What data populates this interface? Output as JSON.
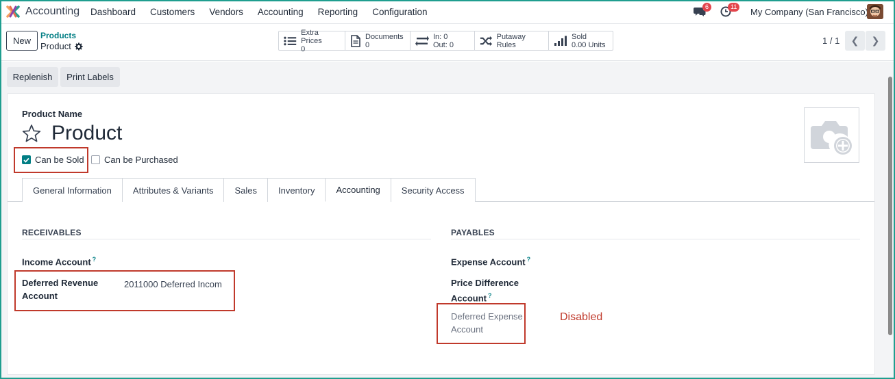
{
  "navbar": {
    "app_name": "Accounting",
    "menu": [
      "Dashboard",
      "Customers",
      "Vendors",
      "Accounting",
      "Reporting",
      "Configuration"
    ],
    "chat_badge": "6",
    "activity_badge": "11",
    "company": "My Company (San Francisco)"
  },
  "control_panel": {
    "new_label": "New",
    "breadcrumb_parent": "Products",
    "breadcrumb_current": "Product",
    "smart_buttons": [
      {
        "icon": "list-icon",
        "label": "Extra Prices",
        "value": "0"
      },
      {
        "icon": "document-icon",
        "label": "Documents",
        "value": "0"
      },
      {
        "icon": "transfer-icon",
        "label": "In: 0",
        "value": "Out: 0"
      },
      {
        "icon": "shuffle-icon",
        "label": "Putaway Rules",
        "value": ""
      },
      {
        "icon": "bar-chart-icon",
        "label": "Sold",
        "value": "0.00 Units"
      }
    ],
    "pager": "1 / 1"
  },
  "actions": {
    "replenish": "Replenish",
    "print_labels": "Print Labels"
  },
  "form": {
    "product_name_label": "Product Name",
    "product_name": "Product",
    "can_be_sold": "Can be Sold",
    "can_be_purchased": "Can be Purchased",
    "tabs": [
      "General Information",
      "Attributes & Variants",
      "Sales",
      "Inventory",
      "Accounting",
      "Security Access"
    ],
    "active_tab": "Accounting",
    "receivables": {
      "title": "RECEIVABLES",
      "income_account": "Income Account",
      "deferred_revenue_line1": "Deferred Revenue",
      "deferred_revenue_line2": "Account",
      "deferred_revenue_value": "2011000 Deferred Incom"
    },
    "payables": {
      "title": "PAYABLES",
      "expense_account": "Expense Account",
      "price_diff_line1": "Price Difference",
      "price_diff_line2": "Account",
      "deferred_expense_line1": "Deferred Expense",
      "deferred_expense_line2": "Account"
    },
    "help_mark": "?"
  },
  "annotation": {
    "disabled": "Disabled"
  },
  "colors": {
    "accent": "#017e84",
    "annotation_red": "#c0392b",
    "badge_red": "#e3454c",
    "frame_teal": "#1f9e8f"
  }
}
